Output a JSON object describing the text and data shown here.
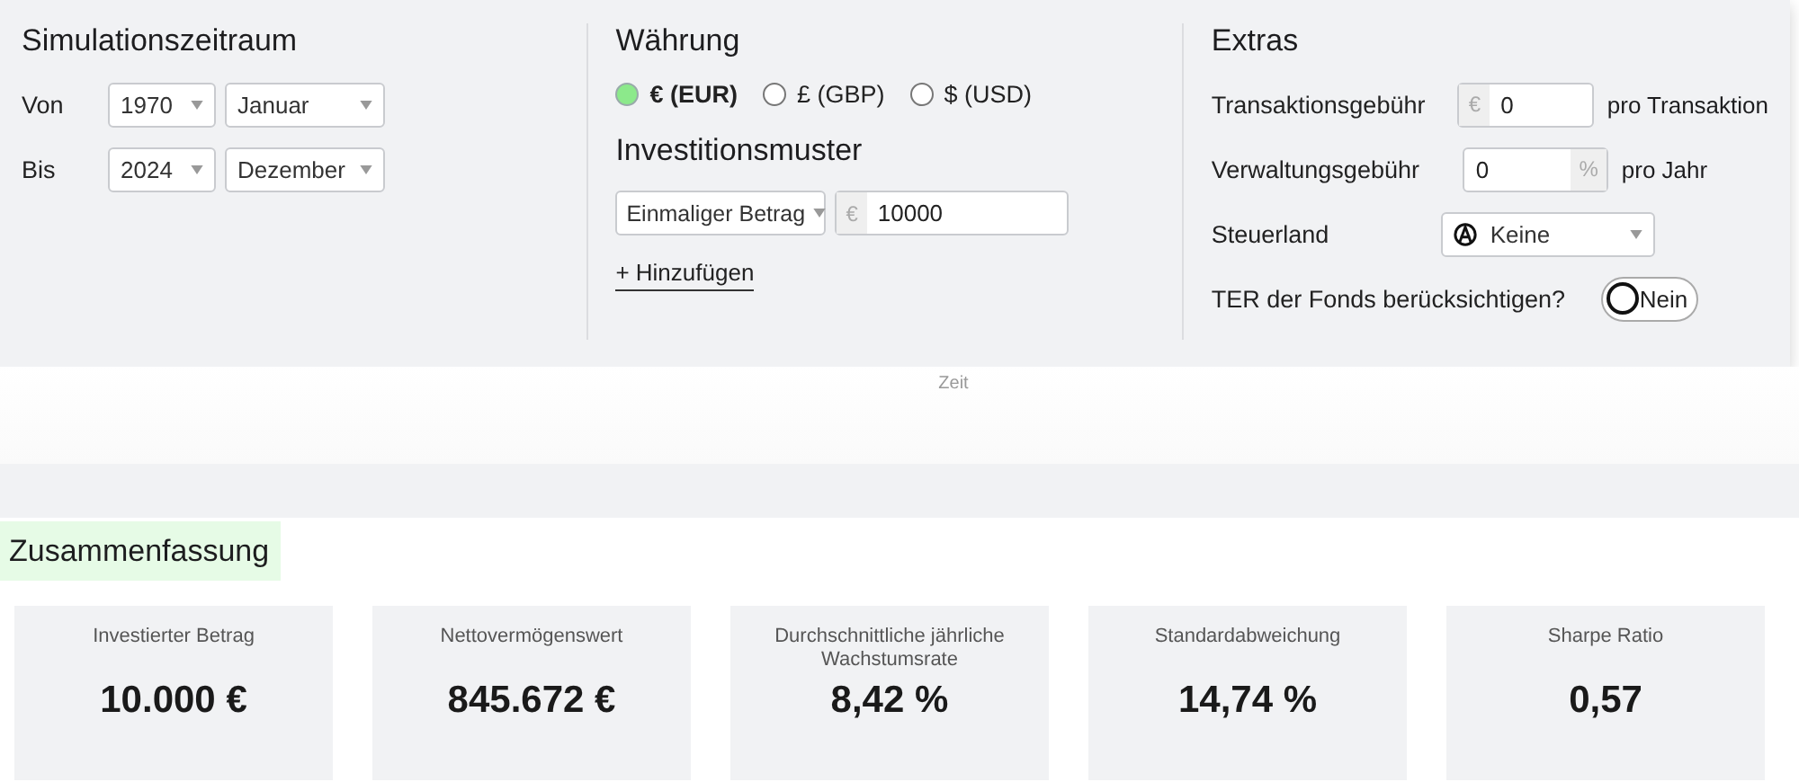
{
  "simulation": {
    "title": "Simulationszeitraum",
    "rows": [
      {
        "label": "Von",
        "year": "1970",
        "month": "Januar"
      },
      {
        "label": "Bis",
        "year": "2024",
        "month": "Dezember"
      }
    ]
  },
  "currency": {
    "title": "Währung",
    "options": [
      {
        "label": "€ (EUR)",
        "selected": true
      },
      {
        "label": "£ (GBP)",
        "selected": false
      },
      {
        "label": "$ (USD)",
        "selected": false
      }
    ]
  },
  "investment": {
    "title": "Investitionsmuster",
    "pattern": "Einmaliger Betrag",
    "prefix": "€",
    "amount": "10000",
    "add_link": "+ Hinzufügen"
  },
  "extras": {
    "title": "Extras",
    "rows": [
      {
        "kind": "fee",
        "label": "Transaktionsgebühr",
        "prefix": "€",
        "value": "0",
        "unit": "pro Transaktion"
      },
      {
        "kind": "fee",
        "label": "Verwaltungsgebühr",
        "value": "0",
        "suffix": "%",
        "unit": "pro Jahr"
      },
      {
        "kind": "select",
        "label": "Steuerland",
        "value": "Keine"
      },
      {
        "kind": "toggle",
        "label": "TER der Fonds berücksichtigen?",
        "on": false,
        "value": "Nein"
      }
    ]
  },
  "chart_axis_label": "Zeit",
  "summary": {
    "title": "Zusammenfassung",
    "cards": [
      {
        "label": "Investierter Betrag",
        "value": "10.000 €"
      },
      {
        "label": "Nettovermögenswert",
        "value": "845.672 €"
      },
      {
        "label": "Durchschnittliche jährliche Wachstumsrate",
        "value": "8,42 %"
      },
      {
        "label": "Standardabweichung",
        "value": "14,74 %"
      },
      {
        "label": "Sharpe Ratio",
        "value": "0,57"
      }
    ]
  }
}
